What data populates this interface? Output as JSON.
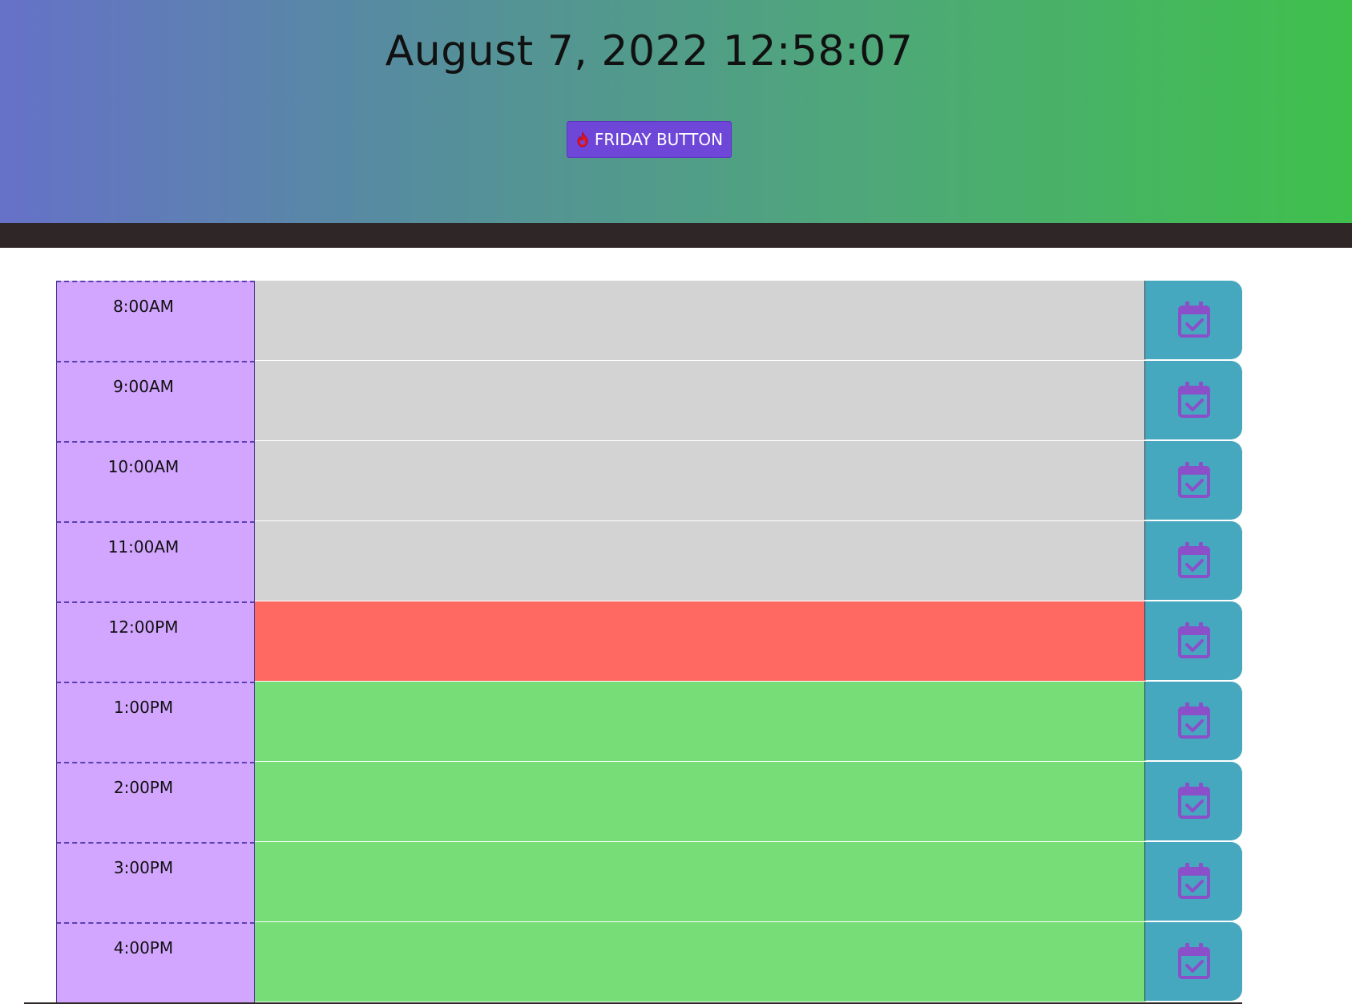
{
  "header": {
    "datetime": "August 7, 2022 12:58:07",
    "friday_button_label": "FRIDAY BUTTON",
    "friday_button_icon": "fire-icon"
  },
  "colors": {
    "past": "#d3d3d3",
    "present": "#ff6961",
    "future": "#77dd77",
    "hour_bg": "#d2a6ff",
    "save_bg": "#46a8bf",
    "button_bg": "#6e47d8"
  },
  "save_icon": "calendar-check-icon",
  "rows": [
    {
      "time": "8:00AM",
      "state": "past",
      "text": ""
    },
    {
      "time": "9:00AM",
      "state": "past",
      "text": ""
    },
    {
      "time": "10:00AM",
      "state": "past",
      "text": ""
    },
    {
      "time": "11:00AM",
      "state": "past",
      "text": ""
    },
    {
      "time": "12:00PM",
      "state": "present",
      "text": ""
    },
    {
      "time": "1:00PM",
      "state": "future",
      "text": ""
    },
    {
      "time": "2:00PM",
      "state": "future",
      "text": ""
    },
    {
      "time": "3:00PM",
      "state": "future",
      "text": ""
    },
    {
      "time": "4:00PM",
      "state": "future",
      "text": ""
    }
  ]
}
